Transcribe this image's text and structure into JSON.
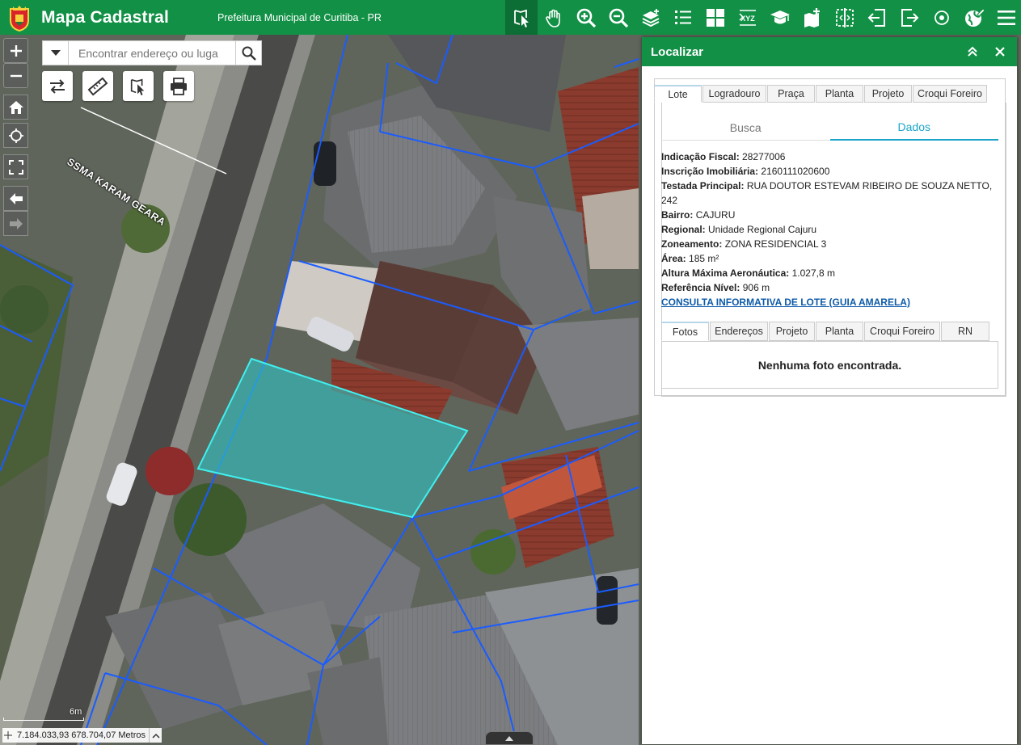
{
  "header": {
    "app_title": "Mapa Cadastral",
    "subtitle": "Prefeitura Municipal de Curitiba - PR",
    "tools": [
      {
        "name": "identify-tool",
        "icon": "map-pointer-icon",
        "active": true
      },
      {
        "name": "pan-tool",
        "icon": "hand-icon"
      },
      {
        "name": "zoom-in-tool",
        "icon": "zoom-in-icon"
      },
      {
        "name": "zoom-out-tool",
        "icon": "zoom-out-icon"
      },
      {
        "name": "layers-tool",
        "icon": "layers-icon"
      },
      {
        "name": "legend-tool",
        "icon": "list-icon"
      },
      {
        "name": "basemap-tool",
        "icon": "grid-icon"
      },
      {
        "name": "coordinates-tool",
        "icon": "xyz-icon",
        "text": "XYZ"
      },
      {
        "name": "education-tool",
        "icon": "graduation-cap-icon"
      },
      {
        "name": "add-data-tool",
        "icon": "add-map-icon"
      },
      {
        "name": "swipe-tool",
        "icon": "split-icon"
      },
      {
        "name": "import-tool",
        "icon": "login-icon"
      },
      {
        "name": "export-tool",
        "icon": "logout-icon"
      },
      {
        "name": "locate-tool",
        "icon": "target-icon"
      },
      {
        "name": "globe-tool",
        "icon": "globe-pencil-icon"
      },
      {
        "name": "menu-tool",
        "icon": "hamburger-icon"
      }
    ]
  },
  "map": {
    "street_label": "SSMA KARAM GEARA",
    "search_placeholder": "Encontrar endereço ou luga",
    "scale_label": "6m",
    "coordinates": "7.184.033,93 678.704,07 Metros",
    "colors": {
      "parcel_line": "#1a5cff",
      "selected_fill": "#2ec5c5",
      "selected_line": "#3ff0f0"
    }
  },
  "panel": {
    "title": "Localizar",
    "main_tabs": [
      "Lote",
      "Logradouro",
      "Praça",
      "Planta",
      "Projeto",
      "Croqui Foreiro"
    ],
    "active_main_tab": "Lote",
    "sub_tabs": [
      "Busca",
      "Dados"
    ],
    "active_sub_tab": "Dados",
    "details": [
      {
        "label": "Indicação Fiscal:",
        "value": "28277006"
      },
      {
        "label": "Inscrição Imobiliária:",
        "value": "2160111020600"
      },
      {
        "label": "Testada Principal:",
        "value": "RUA DOUTOR ESTEVAM RIBEIRO DE SOUZA NETTO, 242"
      },
      {
        "label": "Bairro:",
        "value": "CAJURU"
      },
      {
        "label": "Regional:",
        "value": "Unidade Regional Cajuru"
      },
      {
        "label": "Zoneamento:",
        "value": "ZONA RESIDENCIAL 3"
      },
      {
        "label": "Área:",
        "value": "185 m²"
      },
      {
        "label": "Altura Máxima Aeronáutica:",
        "value": "1.027,8 m"
      },
      {
        "label": "Referência Nível:",
        "value": "906 m"
      }
    ],
    "link": "CONSULTA INFORMATIVA DE LOTE (GUIA AMARELA)",
    "photo_tabs": [
      "Fotos",
      "Endereços",
      "Projeto",
      "Planta",
      "Croqui Foreiro",
      "RN"
    ],
    "active_photo_tab": "Fotos",
    "no_photo": "Nenhuma foto encontrada."
  }
}
